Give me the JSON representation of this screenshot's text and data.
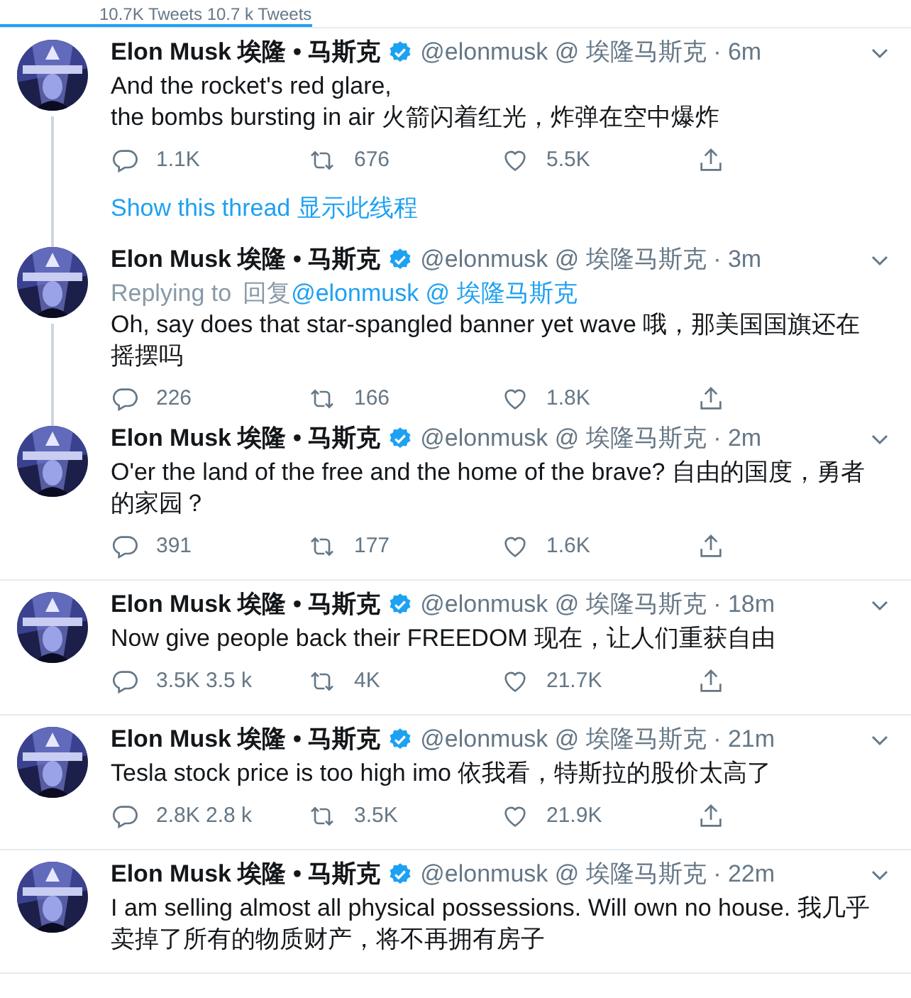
{
  "header": {
    "tab_label": "10.7K Tweets 10.7 k Tweets"
  },
  "tweets": [
    {
      "name": "Elon Musk 埃隆 • 马斯克",
      "verified": true,
      "handle": "@elonmusk @ 埃隆马斯克 · 6m",
      "body": "And the rocket's red glare,\nthe bombs bursting in air 火箭闪着红光，炸弹在空中爆炸",
      "actions": {
        "replies": "1.1K",
        "retweets": "676",
        "likes": "5.5K"
      },
      "show_thread": "Show this thread 显示此线程",
      "connected_above": false,
      "connected_below": true
    },
    {
      "name": "Elon Musk 埃隆 • 马斯克",
      "verified": true,
      "handle": "@elonmusk @ 埃隆马斯克 · 3m",
      "replying": {
        "label": "Replying to",
        "prefix": "回复",
        "link": "@elonmusk @ 埃隆马斯克"
      },
      "body": "Oh, say does that star-spangled banner yet wave 哦，那美国国旗还在摇摆吗",
      "actions": {
        "replies": "226",
        "retweets": "166",
        "likes": "1.8K"
      },
      "connected_above": true,
      "connected_below": true
    },
    {
      "name": "Elon Musk 埃隆 • 马斯克",
      "verified": true,
      "handle": "@elonmusk @ 埃隆马斯克 · 2m",
      "body": "O'er the land of the free and the home of the brave? 自由的国度，勇者的家园？",
      "actions": {
        "replies": "391",
        "retweets": "177",
        "likes": "1.6K"
      },
      "connected_above": true,
      "connected_below": false
    },
    {
      "name": "Elon Musk 埃隆 • 马斯克",
      "verified": true,
      "handle": "@elonmusk @ 埃隆马斯克 · 18m",
      "body": "Now give people back their FREEDOM 现在，让人们重获自由",
      "actions": {
        "replies": "3.5K 3.5 k",
        "retweets": "4K",
        "likes": "21.7K"
      },
      "connected_above": false,
      "connected_below": false
    },
    {
      "name": "Elon Musk 埃隆 • 马斯克",
      "verified": true,
      "handle": "@elonmusk @ 埃隆马斯克 · 21m",
      "body": "Tesla stock price is too high imo 依我看，特斯拉的股价太高了",
      "actions": {
        "replies": "2.8K 2.8 k",
        "retweets": "3.5K",
        "likes": "21.9K"
      },
      "connected_above": false,
      "connected_below": false
    },
    {
      "name": "Elon Musk 埃隆 • 马斯克",
      "verified": true,
      "handle": "@elonmusk @ 埃隆马斯克 · 22m",
      "body": "I am selling almost all physical possessions. Will own no house. 我几乎卖掉了所有的物质财产，将不再拥有房子",
      "connected_above": false,
      "connected_below": false
    }
  ]
}
